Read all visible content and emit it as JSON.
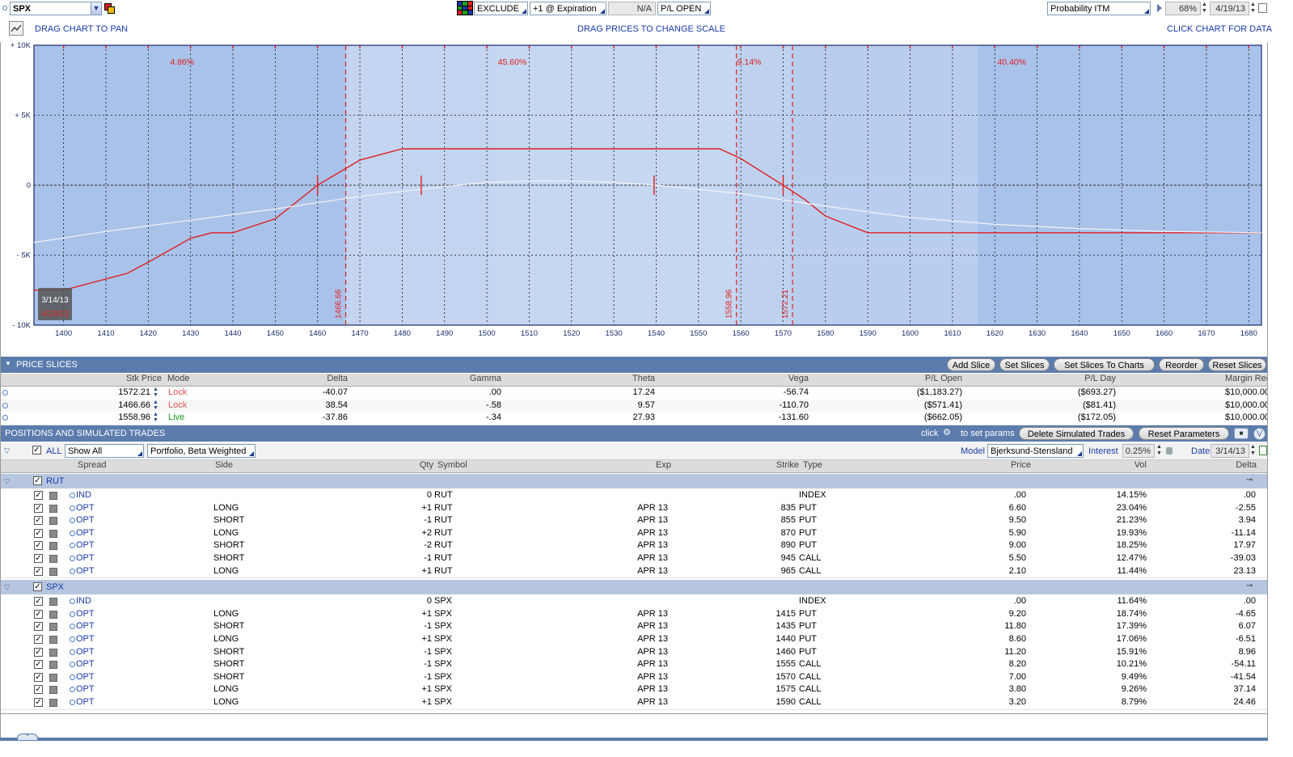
{
  "toolbar": {
    "symbol": "SPX",
    "exclude_label": "EXCLUDE",
    "expiration_select": "+1 @ Expiration",
    "na_label": "N/A",
    "pl_select": "P/L OPEN",
    "prob_select": "Probability ITM",
    "percent": "68%",
    "date": "4/19/13",
    "drag_pan": "DRAG CHART TO PAN",
    "drag_prices": "DRAG PRICES TO CHANGE SCALE",
    "click_chart": "CLICK CHART FOR DATA"
  },
  "chart_data": {
    "type": "line",
    "x_ticks": [
      "1400",
      "1410",
      "1420",
      "1430",
      "1440",
      "1450",
      "1460",
      "1470",
      "1480",
      "1490",
      "1500",
      "1510",
      "1520",
      "1530",
      "1540",
      "1550",
      "1560",
      "1570",
      "1580",
      "1590",
      "1600",
      "1610",
      "1620",
      "1630",
      "1640",
      "1650",
      "1660",
      "1670",
      "1680"
    ],
    "y_ticks": [
      "+ 10K",
      "+ 5K",
      "0",
      "- 5K",
      "- 10K"
    ],
    "xlim": [
      1393,
      1683
    ],
    "ylim": [
      -10000,
      10000
    ],
    "prob_labels": [
      "4.86%",
      "45.60%",
      "9.14%",
      "40.40%"
    ],
    "prob_zones": [
      [
        1393,
        1466.66
      ],
      [
        1466.66,
        1558.96
      ],
      [
        1558.96,
        1572.21
      ],
      [
        1572.21,
        1683
      ]
    ],
    "slice_lines": [
      {
        "x": 1466.66,
        "label": "1466.66"
      },
      {
        "x": 1558.96,
        "label": "1558.96"
      },
      {
        "x": 1572.21,
        "label": "1572.21"
      }
    ],
    "date_label_top": "3/14/13",
    "date_label_bottom": "4/19/13",
    "grid": true,
    "series": [
      {
        "color": "#e02020",
        "x": [
          1393,
          1400,
          1410,
          1415,
          1420,
          1430,
          1435,
          1440,
          1450,
          1460,
          1470,
          1480,
          1490,
          1500,
          1540,
          1550,
          1555,
          1560,
          1570,
          1575,
          1580,
          1590,
          1683
        ],
        "y": [
          -7500,
          -7500,
          -6700,
          -6300,
          -5500,
          -3800,
          -3400,
          -3400,
          -2400,
          0,
          1800,
          2600,
          2600,
          2600,
          2600,
          2600,
          2600,
          1900,
          0,
          -1000,
          -2200,
          -3400,
          -3400
        ]
      },
      {
        "color": "#f4f4f4",
        "x": [
          1393,
          1410,
          1430,
          1450,
          1470,
          1490,
          1500,
          1510,
          1520,
          1530,
          1540,
          1560,
          1580,
          1600,
          1620,
          1640,
          1660,
          1683
        ],
        "y": [
          -4100,
          -3300,
          -2500,
          -1700,
          -800,
          -100,
          200,
          300,
          300,
          200,
          0,
          -600,
          -1500,
          -2300,
          -2800,
          -3100,
          -3300,
          -3400
        ]
      }
    ],
    "markers": [
      {
        "x": 1460,
        "y": 0
      },
      {
        "x": 1484.5,
        "y": 0
      },
      {
        "x": 1539.5,
        "y": 0
      },
      {
        "x": 1570,
        "y": 0
      }
    ]
  },
  "price_slices": {
    "title": "PRICE SLICES",
    "buttons": [
      "Add Slice",
      "Set Slices",
      "Set Slices To Charts",
      "Reorder",
      "Reset Slices"
    ],
    "headers": [
      "Stk Price",
      "Mode",
      "Delta",
      "Gamma",
      "Theta",
      "Vega",
      "P/L Open",
      "P/L Day",
      "Margin Rec"
    ],
    "rows": [
      {
        "price": "1572.21",
        "mode": "Lock",
        "delta": "-40.07",
        "gamma": ".00",
        "theta": "17.24",
        "vega": "-56.74",
        "pl_open": "($1,183.27)",
        "pl_day": "($693.27)",
        "margin": "$10,000.00"
      },
      {
        "price": "1466.66",
        "mode": "Lock",
        "delta": "38.54",
        "gamma": "-.58",
        "theta": "9.57",
        "vega": "-110.70",
        "pl_open": "($571.41)",
        "pl_day": "($81.41)",
        "margin": "$10,000.00"
      },
      {
        "price": "1558.96",
        "mode": "Live",
        "delta": "-37.86",
        "gamma": "-.34",
        "theta": "27.93",
        "vega": "-131.60",
        "pl_open": "($662.05)",
        "pl_day": "($172.05)",
        "margin": "$10,000.00"
      }
    ],
    "colors": {
      "lock": "#e05050",
      "live": "#1a9a1a"
    }
  },
  "positions": {
    "title": "POSITIONS AND SIMULATED TRADES",
    "click_label": "click",
    "set_params_label": "to set params",
    "delete_btn": "Delete Simulated Trades",
    "reset_btn": "Reset Parameters",
    "all_label": "ALL",
    "show_select": "Show All",
    "portfolio_select": "Portfolio, Beta Weighted",
    "model_label": "Model",
    "model_select": "Bjerksund-Stensland",
    "interest_label": "Interest",
    "interest_value": "0.25%",
    "date_label": "Date",
    "date_value": "3/14/13",
    "headers": [
      "Spread",
      "Side",
      "Qty",
      "Symbol",
      "Exp",
      "Strike",
      "Type",
      "Price",
      "Vol",
      "Delta"
    ],
    "groups": [
      {
        "name": "RUT",
        "rows": [
          {
            "spread": "IND",
            "side": "",
            "qty": "0",
            "symbol": "RUT",
            "exp": "",
            "strike": "",
            "type": "INDEX",
            "price": ".00",
            "vol": "14.15%",
            "delta": ".00"
          },
          {
            "spread": "OPT",
            "side": "LONG",
            "qty": "+1",
            "symbol": "RUT",
            "exp": "APR 13",
            "strike": "835",
            "type": "PUT",
            "price": "6.60",
            "vol": "23.04%",
            "delta": "-2.55"
          },
          {
            "spread": "OPT",
            "side": "SHORT",
            "qty": "-1",
            "symbol": "RUT",
            "exp": "APR 13",
            "strike": "855",
            "type": "PUT",
            "price": "9.50",
            "vol": "21.23%",
            "delta": "3.94"
          },
          {
            "spread": "OPT",
            "side": "LONG",
            "qty": "+2",
            "symbol": "RUT",
            "exp": "APR 13",
            "strike": "870",
            "type": "PUT",
            "price": "5.90",
            "vol": "19.93%",
            "delta": "-11.14"
          },
          {
            "spread": "OPT",
            "side": "SHORT",
            "qty": "-2",
            "symbol": "RUT",
            "exp": "APR 13",
            "strike": "890",
            "type": "PUT",
            "price": "9.00",
            "vol": "18.25%",
            "delta": "17.97"
          },
          {
            "spread": "OPT",
            "side": "SHORT",
            "qty": "-1",
            "symbol": "RUT",
            "exp": "APR 13",
            "strike": "945",
            "type": "CALL",
            "price": "5.50",
            "vol": "12.47%",
            "delta": "-39.03"
          },
          {
            "spread": "OPT",
            "side": "LONG",
            "qty": "+1",
            "symbol": "RUT",
            "exp": "APR 13",
            "strike": "965",
            "type": "CALL",
            "price": "2.10",
            "vol": "11.44%",
            "delta": "23.13"
          }
        ]
      },
      {
        "name": "SPX",
        "rows": [
          {
            "spread": "IND",
            "side": "",
            "qty": "0",
            "symbol": "SPX",
            "exp": "",
            "strike": "",
            "type": "INDEX",
            "price": ".00",
            "vol": "11.64%",
            "delta": ".00"
          },
          {
            "spread": "OPT",
            "side": "LONG",
            "qty": "+1",
            "symbol": "SPX",
            "exp": "APR 13",
            "strike": "1415",
            "type": "PUT",
            "price": "9.20",
            "vol": "18.74%",
            "delta": "-4.65"
          },
          {
            "spread": "OPT",
            "side": "SHORT",
            "qty": "-1",
            "symbol": "SPX",
            "exp": "APR 13",
            "strike": "1435",
            "type": "PUT",
            "price": "11.80",
            "vol": "17.39%",
            "delta": "6.07"
          },
          {
            "spread": "OPT",
            "side": "LONG",
            "qty": "+1",
            "symbol": "SPX",
            "exp": "APR 13",
            "strike": "1440",
            "type": "PUT",
            "price": "8.60",
            "vol": "17.06%",
            "delta": "-6.51"
          },
          {
            "spread": "OPT",
            "side": "SHORT",
            "qty": "-1",
            "symbol": "SPX",
            "exp": "APR 13",
            "strike": "1460",
            "type": "PUT",
            "price": "11.20",
            "vol": "15.91%",
            "delta": "8.96"
          },
          {
            "spread": "OPT",
            "side": "SHORT",
            "qty": "-1",
            "symbol": "SPX",
            "exp": "APR 13",
            "strike": "1555",
            "type": "CALL",
            "price": "8.20",
            "vol": "10.21%",
            "delta": "-54.11"
          },
          {
            "spread": "OPT",
            "side": "SHORT",
            "qty": "-1",
            "symbol": "SPX",
            "exp": "APR 13",
            "strike": "1570",
            "type": "CALL",
            "price": "7.00",
            "vol": "9.49%",
            "delta": "-41.54"
          },
          {
            "spread": "OPT",
            "side": "LONG",
            "qty": "+1",
            "symbol": "SPX",
            "exp": "APR 13",
            "strike": "1575",
            "type": "CALL",
            "price": "3.80",
            "vol": "9.26%",
            "delta": "37.14"
          },
          {
            "spread": "OPT",
            "side": "LONG",
            "qty": "+1",
            "symbol": "SPX",
            "exp": "APR 13",
            "strike": "1590",
            "type": "CALL",
            "price": "3.20",
            "vol": "8.79%",
            "delta": "24.46"
          }
        ]
      }
    ]
  }
}
